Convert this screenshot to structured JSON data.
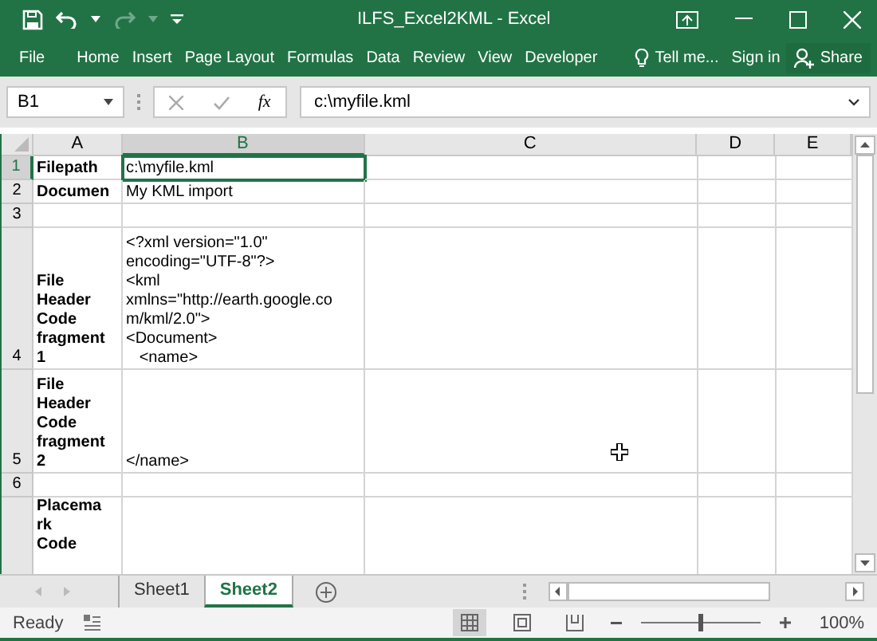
{
  "window": {
    "title": "ILFS_Excel2KML - Excel"
  },
  "ribbon_tabs": [
    {
      "label": "File",
      "selected": false
    },
    {
      "label": "Home",
      "selected": false
    },
    {
      "label": "Insert",
      "selected": false
    },
    {
      "label": "Page Layout",
      "selected": false
    },
    {
      "label": "Formulas",
      "selected": false
    },
    {
      "label": "Data",
      "selected": false
    },
    {
      "label": "Review",
      "selected": false
    },
    {
      "label": "View",
      "selected": false
    },
    {
      "label": "Developer",
      "selected": false
    }
  ],
  "tell_me": "Tell me...",
  "sign_in": "Sign in",
  "share": "Share",
  "formula_bar": {
    "name_box": "B1",
    "fx": "fx",
    "value": "c:\\myfile.kml"
  },
  "columns": [
    {
      "label": "A",
      "selected": false
    },
    {
      "label": "B",
      "selected": true
    },
    {
      "label": "C",
      "selected": false
    },
    {
      "label": "D",
      "selected": false
    },
    {
      "label": "E",
      "selected": false
    }
  ],
  "rows": [
    {
      "number": "1",
      "selected": true,
      "cells": [
        {
          "lines": [
            "Filepath"
          ],
          "bold": true
        },
        {
          "lines": [
            "c:\\myfile.kml"
          ],
          "bold": false,
          "active": true
        }
      ]
    },
    {
      "number": "2",
      "selected": false,
      "cells": [
        {
          "lines": [
            "Documen"
          ],
          "bold": true
        },
        {
          "lines": [
            "My KML import"
          ],
          "bold": false
        }
      ]
    },
    {
      "number": "3",
      "selected": false,
      "cells": []
    },
    {
      "number": "4",
      "selected": false,
      "cells": [
        {
          "lines": [
            "File",
            "Header",
            "Code",
            "fragment",
            "1"
          ],
          "bold": true
        },
        {
          "lines": [
            "<?xml version=\"1.0\"",
            "encoding=\"UTF-8\"?>",
            "<kml",
            "xmlns=\"http://earth.google.co",
            "m/kml/2.0\">",
            "<Document>",
            "   <name>"
          ],
          "bold": false
        }
      ]
    },
    {
      "number": "5",
      "selected": false,
      "cells": [
        {
          "lines": [
            "File",
            "Header",
            "Code",
            "fragment",
            "2"
          ],
          "bold": true
        },
        {
          "lines": [
            "</name>"
          ],
          "bold": false
        }
      ]
    },
    {
      "number": "6",
      "selected": false,
      "cells": []
    },
    {
      "number": "",
      "selected": false,
      "cells": [
        {
          "lines": [
            "Placema",
            "rk",
            "Code"
          ],
          "bold": true
        }
      ]
    }
  ],
  "sheets": [
    {
      "label": "Sheet1",
      "selected": false
    },
    {
      "label": "Sheet2",
      "selected": true
    }
  ],
  "status_bar": {
    "status": "Ready",
    "zoom": "100%",
    "zoom_slider": {
      "level": 0.5
    }
  }
}
